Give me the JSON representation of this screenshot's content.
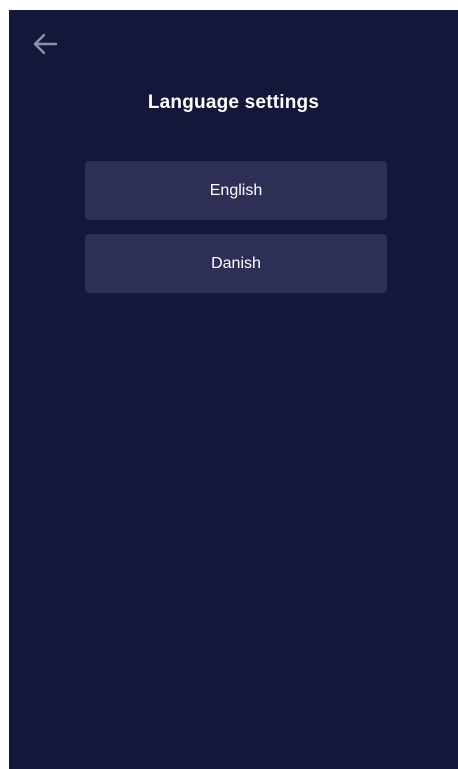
{
  "header": {
    "back_icon": "arrow-left-icon",
    "title": "Language settings"
  },
  "languages": [
    {
      "label": "English"
    },
    {
      "label": "Danish"
    }
  ],
  "colors": {
    "background": "#14173a",
    "option_background": "#2e2f57",
    "icon": "#8f91ab",
    "text": "#ffffff"
  }
}
